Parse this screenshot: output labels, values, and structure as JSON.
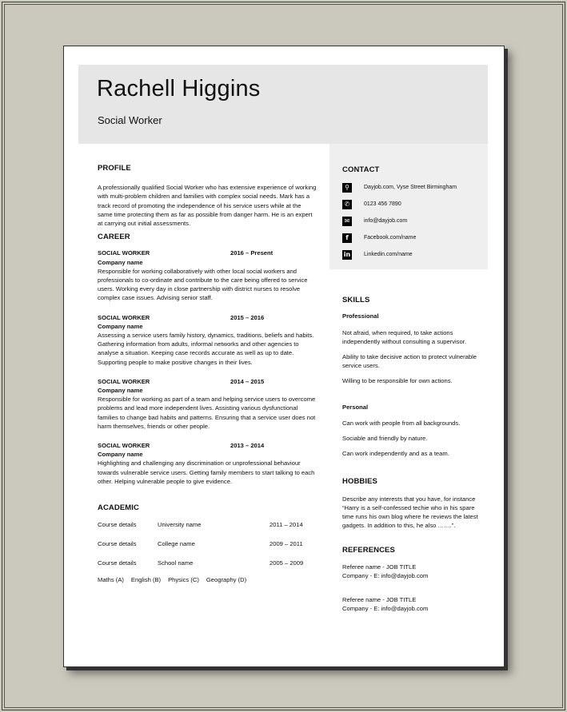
{
  "header": {
    "name": "Rachell Higgins",
    "job_title": "Social Worker"
  },
  "profile": {
    "heading": "PROFILE",
    "text": "A professionally qualified Social Worker who has extensive experience of working with multi-problem children and families with complex social needs. Mark has a track record of promoting the independence of his service users while at the same time protecting them as far as possible from danger harm. He is an expert at carrying out initial assessments."
  },
  "career": {
    "heading": "CAREER",
    "jobs": [
      {
        "role": "SOCIAL WORKER",
        "dates": "2016 – Present",
        "company": "Company name",
        "description": "Responsible for working collaboratively with other local social workers and professionals to co-ordinate and contribute to the care being offered to service users. Working every day in close partnership with district nurses to resolve complex case issues. Advising senior staff."
      },
      {
        "role": "SOCIAL WORKER",
        "dates": "2015 – 2016",
        "company": "Company name",
        "description": "Assessing a service users family history, dynamics, traditions, beliefs and habits. Gathering information from adults, informal networks and other agencies to analyse a situation. Keeping case records accurate as well as up to date. Supporting people to make positive changes in their lives."
      },
      {
        "role": "SOCIAL WORKER",
        "dates": "2014 – 2015",
        "company": "Company name",
        "description": "Responsible for working as part of a team and helping service users to overcome problems and lead more independent lives. Assisting various dysfunctional families to change bad habits and patterns. Ensuring that a service user does not harm themselves, friends or other people."
      },
      {
        "role": "SOCIAL WORKER",
        "dates": "2013 – 2014",
        "company": "Company name",
        "description": "Highlighting and challenging any discrimination or unprofessional behaviour towards vulnerable service users. Getting family members to start talking to each other. Helping vulnerable people to give evidence."
      }
    ]
  },
  "academic": {
    "heading": "ACADEMIC",
    "rows": [
      {
        "course": "Course details",
        "institution": "University name",
        "dates": "2011 – 2014"
      },
      {
        "course": "Course details",
        "institution": "College name",
        "dates": "2009 – 2011"
      },
      {
        "course": "Course details",
        "institution": "School name",
        "dates": "2005 – 2009"
      }
    ],
    "grades": [
      "Maths (A)",
      "English (B)",
      "Physics (C)",
      "Geography (D)"
    ]
  },
  "contact": {
    "heading": "CONTACT",
    "items": [
      {
        "icon": "location-pin-icon",
        "glyph": "⚲",
        "text": "Dayjob.com, Vyse Street Birmingham"
      },
      {
        "icon": "phone-icon",
        "glyph": "✆",
        "text": "0123 456 7890"
      },
      {
        "icon": "email-icon",
        "glyph": "✉",
        "text": "info@dayjob.com"
      },
      {
        "icon": "facebook-icon",
        "glyph": "f",
        "text": "Facebook.com/name"
      },
      {
        "icon": "linkedin-icon",
        "glyph": "in",
        "text": "Linkedin.com/name"
      }
    ]
  },
  "skills": {
    "heading": "SKILLS",
    "professional_heading": "Professional",
    "professional": [
      "Not afraid, when required, to take actions independently without consulting a supervisor.",
      "Ability to take decisive action to protect vulnerable service users.",
      "Willing to be responsible for own actions."
    ],
    "personal_heading": "Personal",
    "personal": [
      "Can work with people from all backgrounds.",
      "Sociable and friendly by nature.",
      "Can work independently and as a team."
    ]
  },
  "hobbies": {
    "heading": "HOBBIES",
    "text": "Describe any interests that you have, for instance “Harry is a self-confessed techie who in his spare time runs his own blog where he reviews the latest gadgets. In addition to this, he also …….”."
  },
  "references": {
    "heading": "REFERENCES",
    "items": [
      {
        "name": "Referee name - JOB TITLE",
        "company": "Company - E: info@dayjob.com"
      },
      {
        "name": "Referee name - JOB TITLE",
        "company": "Company - E: info@dayjob.com"
      }
    ]
  }
}
